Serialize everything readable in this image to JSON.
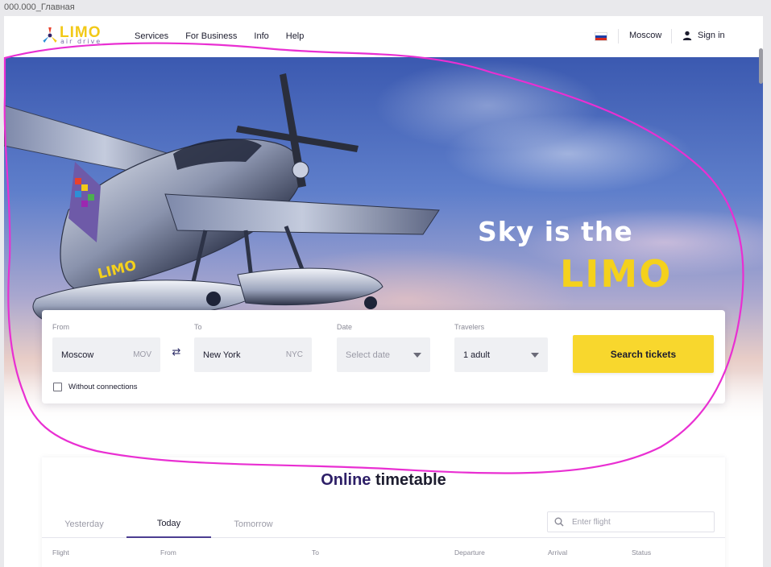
{
  "window": {
    "title": "000.000_Главная"
  },
  "header": {
    "logo_word": "LIMO",
    "logo_sub": "air drive",
    "nav": [
      {
        "label": "Services"
      },
      {
        "label": "For Business"
      },
      {
        "label": "Info"
      },
      {
        "label": "Help"
      }
    ],
    "city": "Moscow",
    "signin": "Sign in",
    "flag_colors": [
      "#ffffff",
      "#1c3fa8",
      "#d52b1e"
    ]
  },
  "hero": {
    "headline_line1": "Sky is the",
    "headline_line2": "LIMO",
    "accent_color": "#f4d11c"
  },
  "search": {
    "from_label": "From",
    "from_value": "Moscow",
    "from_code": "MOV",
    "to_label": "To",
    "to_value": "New York",
    "to_code": "NYC",
    "date_label": "Date",
    "date_placeholder": "Select date",
    "travelers_label": "Travelers",
    "travelers_value": "1 adult",
    "button_label": "Search tickets",
    "button_color": "#f8d72d",
    "without_connections_label": "Without connections",
    "without_connections_checked": false
  },
  "timetable": {
    "title_accent": "Online",
    "title_rest": "timetable",
    "tabs": [
      {
        "label": "Yesterday"
      },
      {
        "label": "Today"
      },
      {
        "label": "Tomorrow"
      }
    ],
    "active_tab": "Today",
    "search_placeholder": "Enter flight",
    "columns": [
      "Flight",
      "From",
      "To",
      "Departure",
      "Arrival",
      "Status"
    ]
  }
}
